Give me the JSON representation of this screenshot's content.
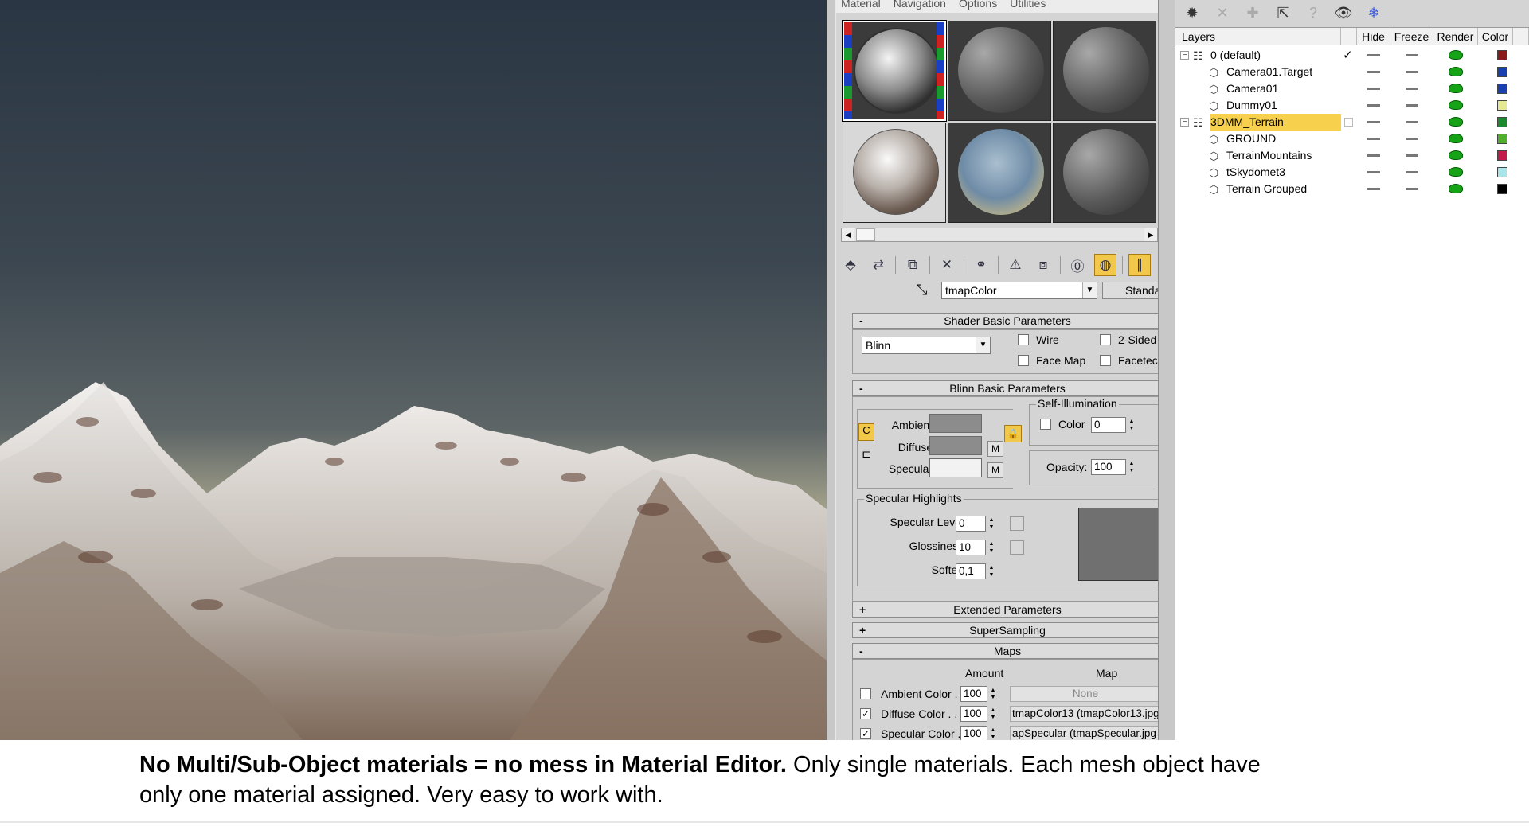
{
  "menu": [
    "Material",
    "Navigation",
    "Options",
    "Utilities"
  ],
  "material_editor": {
    "current_material": "tmapColor",
    "type_button": "Standa",
    "shader_rollout": "Shader Basic Parameters",
    "shader_type": "Blinn",
    "checkboxes": {
      "wire": "Wire",
      "two_sided": "2-Sided",
      "face_map": "Face Map",
      "faceted": "Facetec"
    },
    "blinn_rollout": "Blinn Basic Parameters",
    "self_illum": {
      "group": "Self-Illumination",
      "color": "Color",
      "value": "0"
    },
    "ambient": "Ambient:",
    "diffuse": "Diffuse:",
    "specular": "Specular:",
    "m_label": "M",
    "opacity": {
      "label": "Opacity:",
      "value": "100"
    },
    "spec_highlights": {
      "group": "Specular Highlights",
      "level_label": "Specular Level:",
      "level": "0",
      "gloss_label": "Glossiness:",
      "gloss": "10",
      "soften_label": "Soften:",
      "soften": "0,1"
    },
    "extended": "Extended Parameters",
    "supersampling": "SuperSampling",
    "maps": {
      "title": "Maps",
      "amount": "Amount",
      "map": "Map",
      "rows": [
        {
          "label": "Ambient Color . . .",
          "amount": "100",
          "map": "None",
          "checked": false
        },
        {
          "label": "Diffuse Color . . . .",
          "amount": "100",
          "map": "tmapColor13 (tmapColor13.jpg",
          "checked": true
        },
        {
          "label": "Specular Color . . .",
          "amount": "100",
          "map": "apSpecular (tmapSpecular.jpg",
          "checked": true
        }
      ]
    }
  },
  "layers": {
    "columns": [
      "Layers",
      "Hide",
      "Freeze",
      "Render",
      "Color"
    ],
    "rows": [
      {
        "name": "0 (default)",
        "indent": 0,
        "layer": true,
        "current": true,
        "color": "#8b1a1a"
      },
      {
        "name": "Camera01.Target",
        "indent": 1,
        "color": "#1a3fb0"
      },
      {
        "name": "Camera01",
        "indent": 1,
        "color": "#1a3fb0"
      },
      {
        "name": "Dummy01",
        "indent": 1,
        "color": "#e4e890"
      },
      {
        "name": "3DMM_Terrain",
        "indent": 0,
        "layer": true,
        "selected": true,
        "color": "#1a8a2e"
      },
      {
        "name": "GROUND",
        "indent": 1,
        "color": "#4fb02a"
      },
      {
        "name": "TerrainMountains",
        "indent": 1,
        "color": "#c21a4a"
      },
      {
        "name": "tSkydomet3",
        "indent": 1,
        "color": "#a8e4e8"
      },
      {
        "name": "Terrain Grouped",
        "indent": 1,
        "color": "#000000"
      }
    ]
  },
  "caption": {
    "bold": "No Multi/Sub-Object materials = no mess in Material Editor.",
    "line1": " Only single materials. Each mesh object have",
    "line2": "only one material assigned. Very easy to work with."
  }
}
